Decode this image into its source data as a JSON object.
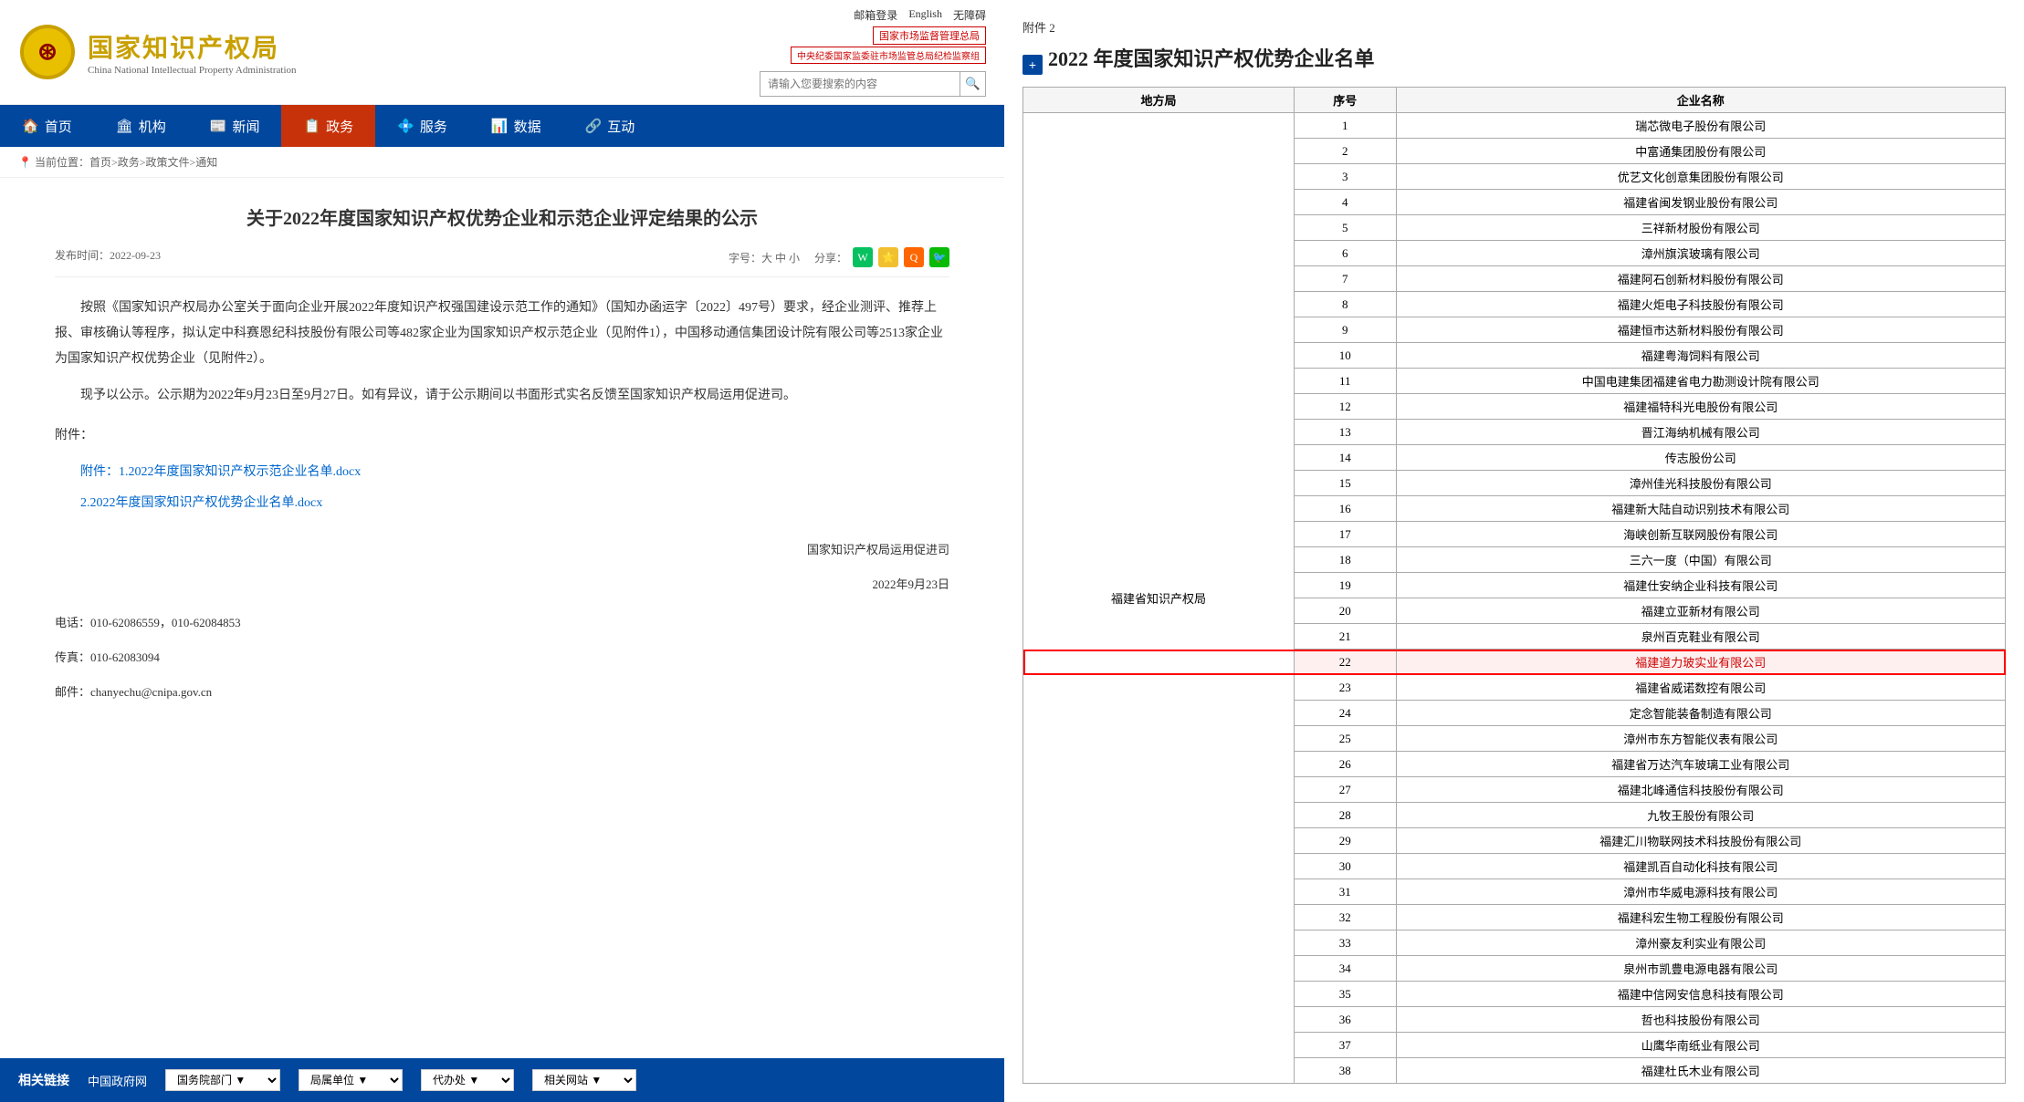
{
  "header": {
    "logo_cn": "国家知识产权局",
    "logo_en": "China National Intellectual Property Administration",
    "top_links": [
      "邮箱登录",
      "English",
      "无障碍"
    ],
    "gov_link1": "国家市场监督管理总局",
    "gov_link2": "中央纪委国家监委驻市场监管总局纪检监察组",
    "search_placeholder": "请输入您要搜索的内容"
  },
  "nav": {
    "items": [
      {
        "label": "首页",
        "icon": "🏠",
        "active": false
      },
      {
        "label": "机构",
        "icon": "🏛",
        "active": false
      },
      {
        "label": "新闻",
        "icon": "📰",
        "active": false
      },
      {
        "label": "政务",
        "icon": "📋",
        "active": true
      },
      {
        "label": "服务",
        "icon": "💠",
        "active": false
      },
      {
        "label": "数据",
        "icon": "📊",
        "active": false
      },
      {
        "label": "互动",
        "icon": "🔗",
        "active": false
      }
    ]
  },
  "breadcrumb": "当前位置：首页>政务>政策文件>通知",
  "article": {
    "title": "关于2022年度国家知识产权优势企业和示范企业评定结果的公示",
    "date": "发布时间：2022-09-23",
    "font_label": "字号：大 中 小",
    "share_label": "分享：",
    "body_p1": "按照《国家知识产权局办公室关于面向企业开展2022年度知识产权强国建设示范工作的通知》（国知办函运字〔2022〕497号）要求，经企业测评、推荐上报、审核确认等程序，拟认定中科赛恩纪科技股份有限公司等482家企业为国家知识产权示范企业（见附件1），中国移动通信集团设计院有限公司等2513家企业为国家知识产权优势企业（见附件2）。",
    "body_p2": "现予以公示。公示期为2022年9月23日至9月27日。如有异议，请于公示期间以书面形式实名反馈至国家知识产权局运用促进司。",
    "attachment_1": "附件：1.2022年度国家知识产权示范企业名单.docx",
    "attachment_2": "2.2022年度国家知识产权优势企业名单.docx",
    "dept": "国家知识产权局运用促进司",
    "date2": "2022年9月23日",
    "tel": "电话：010-62086559，010-62084853",
    "fax": "传真：010-62083094",
    "email": "邮件：chanyechu@cnipa.gov.cn"
  },
  "footer": {
    "links_label": "相关链接",
    "link1": "中国政府网",
    "select1": "国务院部门",
    "select2": "局属单位",
    "select3": "代办处",
    "select4": "相关网站"
  },
  "right_panel": {
    "annex_label": "附件 2",
    "doc_title": "2022 年度国家知识产权优势企业名单",
    "table_headers": [
      "地方局",
      "序号",
      "企业名称"
    ],
    "region": "福建省知识产权局",
    "companies": [
      {
        "no": 1,
        "name": "瑞芯微电子股份有限公司"
      },
      {
        "no": 2,
        "name": "中富通集团股份有限公司"
      },
      {
        "no": 3,
        "name": "优艺文化创意集团股份有限公司"
      },
      {
        "no": 4,
        "name": "福建省闽发钢业股份有限公司"
      },
      {
        "no": 5,
        "name": "三祥新材股份有限公司"
      },
      {
        "no": 6,
        "name": "漳州旗滨玻璃有限公司"
      },
      {
        "no": 7,
        "name": "福建阿石创新材料股份有限公司"
      },
      {
        "no": 8,
        "name": "福建火炬电子科技股份有限公司"
      },
      {
        "no": 9,
        "name": "福建恒市达新材料股份有限公司"
      },
      {
        "no": 10,
        "name": "福建粤海饲料有限公司"
      },
      {
        "no": 11,
        "name": "中国电建集团福建省电力勘测设计院有限公司"
      },
      {
        "no": 12,
        "name": "福建福特科光电股份有限公司"
      },
      {
        "no": 13,
        "name": "晋江海纳机械有限公司"
      },
      {
        "no": 14,
        "name": "传志股份公司"
      },
      {
        "no": 15,
        "name": "漳州佳光科技股份有限公司"
      },
      {
        "no": 16,
        "name": "福建新大陆自动识别技术有限公司"
      },
      {
        "no": 17,
        "name": "海峡创新互联网股份有限公司"
      },
      {
        "no": 18,
        "name": "三六一度（中国）有限公司"
      },
      {
        "no": 19,
        "name": "福建仕安纳企业科技有限公司"
      },
      {
        "no": 20,
        "name": "福建立亚新材有限公司"
      },
      {
        "no": 21,
        "name": "泉州百克鞋业有限公司"
      },
      {
        "no": 22,
        "name": "福建道力玻实业有限公司",
        "highlighted": true
      },
      {
        "no": 23,
        "name": "福建省威诺数控有限公司"
      },
      {
        "no": 24,
        "name": "定念智能装备制造有限公司"
      },
      {
        "no": 25,
        "name": "漳州市东方智能仪表有限公司"
      },
      {
        "no": 26,
        "name": "福建省万达汽车玻璃工业有限公司"
      },
      {
        "no": 27,
        "name": "福建北峰通信科技股份有限公司"
      },
      {
        "no": 28,
        "name": "九牧王股份有限公司"
      },
      {
        "no": 29,
        "name": "福建汇川物联网技术科技股份有限公司"
      },
      {
        "no": 30,
        "name": "福建凯百自动化科技有限公司"
      },
      {
        "no": 31,
        "name": "漳州市华威电源科技有限公司"
      },
      {
        "no": 32,
        "name": "福建科宏生物工程股份有限公司"
      },
      {
        "no": 33,
        "name": "漳州豪友利实业有限公司"
      },
      {
        "no": 34,
        "name": "泉州市凯豊电源电器有限公司"
      },
      {
        "no": 35,
        "name": "福建中信网安信息科技有限公司"
      },
      {
        "no": 36,
        "name": "哲也科技股份有限公司"
      },
      {
        "no": 37,
        "name": "山鹰华南纸业有限公司"
      },
      {
        "no": 38,
        "name": "福建杜氏木业有限公司"
      }
    ]
  }
}
